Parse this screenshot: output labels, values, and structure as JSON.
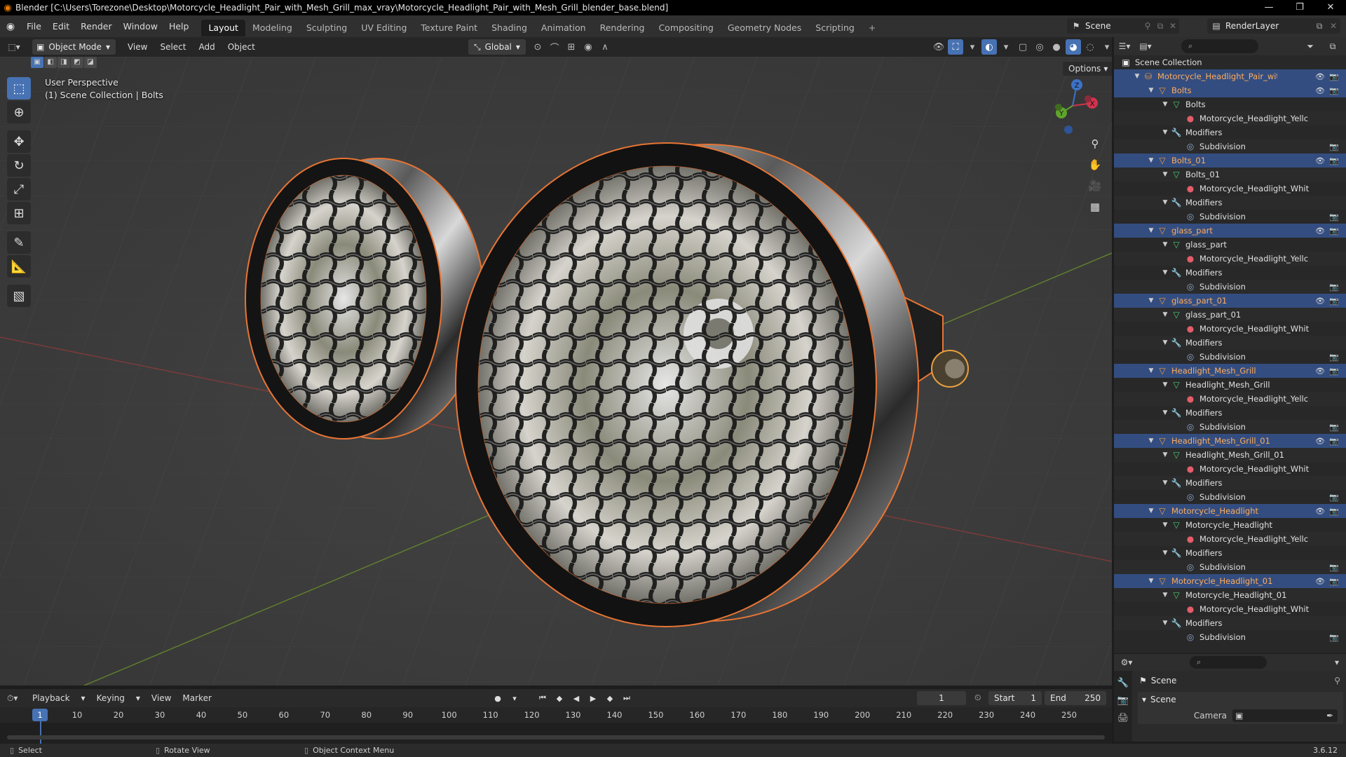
{
  "window": {
    "title": "Blender [C:\\Users\\Torezone\\Desktop\\Motorcycle_Headlight_Pair_with_Mesh_Grill_max_vray\\Motorcycle_Headlight_Pair_with_Mesh_Grill_blender_base.blend]",
    "minimize": "—",
    "restore": "❐",
    "close": "✕"
  },
  "menu": [
    "File",
    "Edit",
    "Render",
    "Window",
    "Help"
  ],
  "workspaces": [
    "Layout",
    "Modeling",
    "Sculpting",
    "UV Editing",
    "Texture Paint",
    "Shading",
    "Animation",
    "Rendering",
    "Compositing",
    "Geometry Nodes",
    "Scripting"
  ],
  "active_workspace": "Layout",
  "scene_name": "Scene",
  "view_layer": "RenderLayer",
  "viewport": {
    "mode": "Object Mode",
    "menu": [
      "View",
      "Select",
      "Add",
      "Object"
    ],
    "orientation": "Global",
    "perspective": "User Perspective",
    "collection_info": "(1) Scene Collection | Bolts",
    "options": "Options"
  },
  "outliner": {
    "search_placeholder": "⌕",
    "root": "Scene Collection",
    "rows": [
      {
        "label": "Motorcycle_Headlight_Pair_with_Mesh_",
        "type": "coll",
        "indent": 1,
        "sel": true,
        "vis": true
      },
      {
        "label": "Bolts",
        "type": "obj",
        "indent": 2,
        "sel": true,
        "vis": true
      },
      {
        "label": "Bolts",
        "type": "mesh",
        "indent": 3
      },
      {
        "label": "Motorcycle_Headlight_Yellc",
        "type": "mat",
        "indent": 4
      },
      {
        "label": "Modifiers",
        "type": "mod",
        "indent": 3
      },
      {
        "label": "Subdivision",
        "type": "subd",
        "indent": 4,
        "cam": true
      },
      {
        "label": "Bolts_01",
        "type": "obj",
        "indent": 2,
        "sel": true,
        "vis": true
      },
      {
        "label": "Bolts_01",
        "type": "mesh",
        "indent": 3
      },
      {
        "label": "Motorcycle_Headlight_Whit",
        "type": "mat",
        "indent": 4
      },
      {
        "label": "Modifiers",
        "type": "mod",
        "indent": 3
      },
      {
        "label": "Subdivision",
        "type": "subd",
        "indent": 4,
        "cam": true
      },
      {
        "label": "glass_part",
        "type": "obj",
        "indent": 2,
        "sel": true,
        "vis": true
      },
      {
        "label": "glass_part",
        "type": "mesh",
        "indent": 3
      },
      {
        "label": "Motorcycle_Headlight_Yellc",
        "type": "mat",
        "indent": 4
      },
      {
        "label": "Modifiers",
        "type": "mod",
        "indent": 3
      },
      {
        "label": "Subdivision",
        "type": "subd",
        "indent": 4,
        "cam": true
      },
      {
        "label": "glass_part_01",
        "type": "obj",
        "indent": 2,
        "sel": true,
        "vis": true
      },
      {
        "label": "glass_part_01",
        "type": "mesh",
        "indent": 3
      },
      {
        "label": "Motorcycle_Headlight_Whit",
        "type": "mat",
        "indent": 4
      },
      {
        "label": "Modifiers",
        "type": "mod",
        "indent": 3
      },
      {
        "label": "Subdivision",
        "type": "subd",
        "indent": 4,
        "cam": true
      },
      {
        "label": "Headlight_Mesh_Grill",
        "type": "obj",
        "indent": 2,
        "sel": true,
        "vis": true
      },
      {
        "label": "Headlight_Mesh_Grill",
        "type": "mesh",
        "indent": 3
      },
      {
        "label": "Motorcycle_Headlight_Yellc",
        "type": "mat",
        "indent": 4
      },
      {
        "label": "Modifiers",
        "type": "mod",
        "indent": 3
      },
      {
        "label": "Subdivision",
        "type": "subd",
        "indent": 4,
        "cam": true
      },
      {
        "label": "Headlight_Mesh_Grill_01",
        "type": "obj",
        "indent": 2,
        "sel": true,
        "vis": true
      },
      {
        "label": "Headlight_Mesh_Grill_01",
        "type": "mesh",
        "indent": 3
      },
      {
        "label": "Motorcycle_Headlight_Whit",
        "type": "mat",
        "indent": 4
      },
      {
        "label": "Modifiers",
        "type": "mod",
        "indent": 3
      },
      {
        "label": "Subdivision",
        "type": "subd",
        "indent": 4,
        "cam": true
      },
      {
        "label": "Motorcycle_Headlight",
        "type": "obj",
        "indent": 2,
        "sel": true,
        "vis": true
      },
      {
        "label": "Motorcycle_Headlight",
        "type": "mesh",
        "indent": 3
      },
      {
        "label": "Motorcycle_Headlight_Yellc",
        "type": "mat",
        "indent": 4
      },
      {
        "label": "Modifiers",
        "type": "mod",
        "indent": 3
      },
      {
        "label": "Subdivision",
        "type": "subd",
        "indent": 4,
        "cam": true
      },
      {
        "label": "Motorcycle_Headlight_01",
        "type": "obj",
        "indent": 2,
        "sel": true,
        "vis": true
      },
      {
        "label": "Motorcycle_Headlight_01",
        "type": "mesh",
        "indent": 3
      },
      {
        "label": "Motorcycle_Headlight_Whit",
        "type": "mat",
        "indent": 4
      },
      {
        "label": "Modifiers",
        "type": "mod",
        "indent": 3
      },
      {
        "label": "Subdivision",
        "type": "subd",
        "indent": 4,
        "cam": true
      }
    ]
  },
  "properties": {
    "title": "Scene",
    "panel": "Scene",
    "camera_label": "Camera"
  },
  "timeline": {
    "menu": [
      "Playback",
      "Keying",
      "View",
      "Marker"
    ],
    "current_frame": "1",
    "start_label": "Start",
    "start": "1",
    "end_label": "End",
    "end": "250",
    "ticks": [
      "10",
      "20",
      "30",
      "40",
      "50",
      "60",
      "70",
      "80",
      "90",
      "100",
      "110",
      "120",
      "130",
      "140",
      "150",
      "160",
      "170",
      "180",
      "190",
      "200",
      "210",
      "220",
      "230",
      "240",
      "250"
    ]
  },
  "statusbar": {
    "select": "Select",
    "rotate": "Rotate View",
    "context": "Object Context Menu",
    "version": "3.6.12"
  },
  "gizmo": {
    "x": "X",
    "y": "Y",
    "z": "Z"
  }
}
